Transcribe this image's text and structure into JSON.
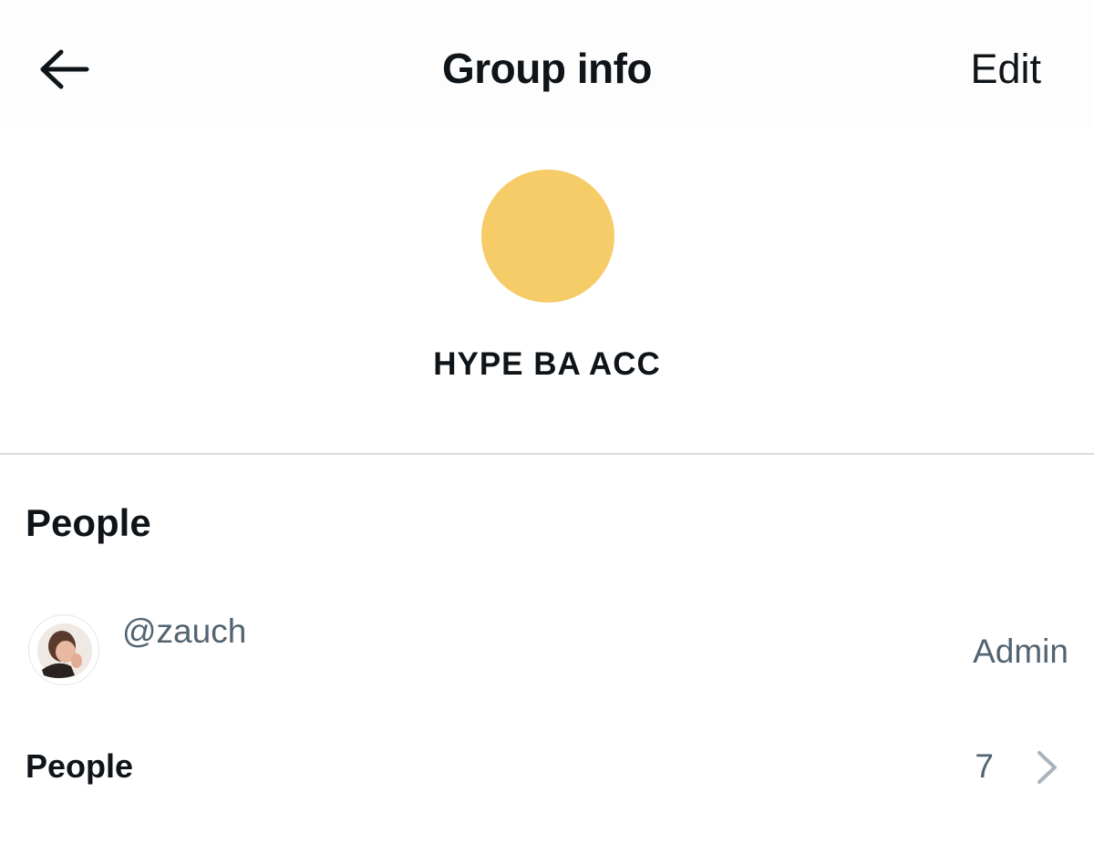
{
  "header": {
    "back_icon": "arrow-left-icon",
    "title": "Group info",
    "edit_label": "Edit"
  },
  "group": {
    "avatar_color": "#f5cc68",
    "name": "HYPE BA ACC"
  },
  "people_section": {
    "heading": "People",
    "members": [
      {
        "handle": "@zauch",
        "role": "Admin"
      }
    ],
    "people_row": {
      "label": "People",
      "count": "7",
      "chevron_icon": "chevron-right-icon"
    }
  },
  "colors": {
    "text_primary": "#0f1419",
    "text_secondary": "#536471",
    "divider": "#dcdcdc",
    "chevron": "#a9b4bd"
  }
}
